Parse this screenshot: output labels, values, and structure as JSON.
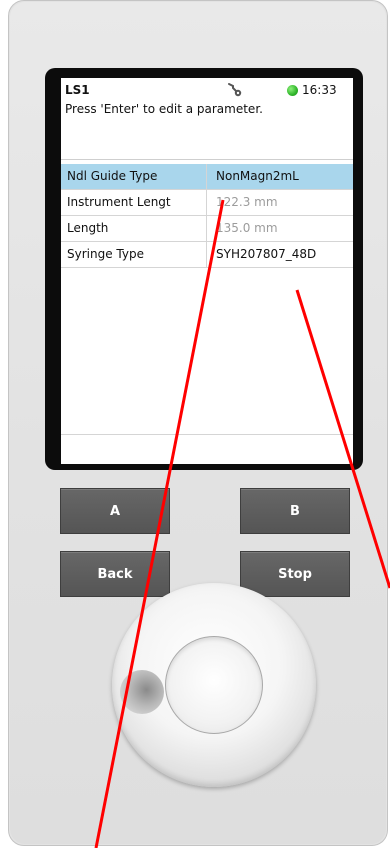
{
  "screen": {
    "title": "LS1",
    "clock": "16:33",
    "hint": "Press 'Enter' to edit a parameter.",
    "status_led_color": "#2fb52a",
    "icons": [
      "wrench-icon",
      "status-led"
    ]
  },
  "parameters": [
    {
      "name": "Ndl Guide Type",
      "value": "NonMagn2mL",
      "selected": true,
      "editable": true
    },
    {
      "name": "Instrument Lengt",
      "value": "122.3 mm",
      "selected": false,
      "editable": false
    },
    {
      "name": "Length",
      "value": "135.0 mm",
      "selected": false,
      "editable": false
    },
    {
      "name": "Syringe Type",
      "value": "SYH207807_48D",
      "selected": false,
      "editable": true
    }
  ],
  "buttons": {
    "a": "A",
    "b": "B",
    "back": "Back",
    "stop": "Stop"
  },
  "colors": {
    "selected_row": "#a9d6ec",
    "button_bg": "#5e5e5e",
    "annotation_lines": "#ff0000"
  }
}
